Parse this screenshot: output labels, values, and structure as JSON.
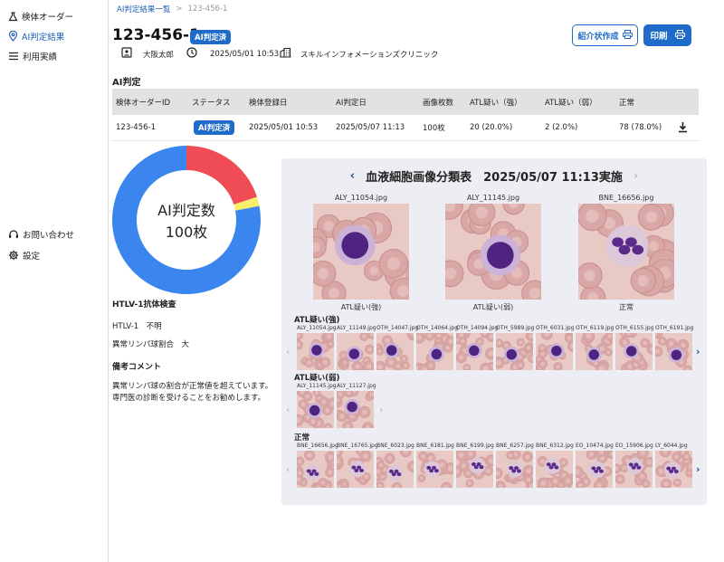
{
  "sidebar": {
    "items": [
      {
        "label": "検体オーダー",
        "icon": "flask-icon"
      },
      {
        "label": "AI判定結果",
        "icon": "location-pin-icon"
      },
      {
        "label": "利用実績",
        "icon": "list-icon"
      }
    ],
    "bottom_items": [
      {
        "label": "お問い合わせ",
        "icon": "headset-icon"
      },
      {
        "label": "設定",
        "icon": "gear-icon"
      }
    ]
  },
  "breadcrumb": {
    "parent": "AI判定結果一覧",
    "separator": ">",
    "current": "123-456-1"
  },
  "header": {
    "title": "123-456-1",
    "status_badge": "AI判定済",
    "patient_name": "大阪太郎",
    "datetime": "2025/05/01 10:53",
    "clinic": "スキルインフォメーションズクリニック",
    "referral_button": "紹介状作成",
    "print_button": "印刷"
  },
  "section_title": "AI判定",
  "table": {
    "headers": [
      "検体オーダーID",
      "ステータス",
      "検体登録日",
      "AI判定日",
      "画像枚数",
      "ATL疑い（強）",
      "ATL疑い（弱）",
      "正常"
    ],
    "row": {
      "order_id": "123-456-1",
      "status": "AI判定済",
      "registered": "2025/05/01 10:53",
      "ai_date": "2025/05/07 11:13",
      "image_count": "100枚",
      "atl_strong": "20 (20.0%)",
      "atl_weak": "2 (2.0%)",
      "normal": "78 (78.0%)"
    }
  },
  "donut": {
    "center_label": "AI判定数",
    "center_value": "100枚",
    "segments": [
      {
        "name": "ATL疑い（強）",
        "value": 20,
        "color": "#f04c55"
      },
      {
        "name": "ATL疑い（弱）",
        "value": 2,
        "color": "#f7ee6a"
      },
      {
        "name": "正常",
        "value": 78,
        "color": "#3b86ee"
      }
    ]
  },
  "antibody": {
    "title": "HTLV-1抗体検査",
    "htlv": "HTLV-1　不明",
    "abnormal_ratio": "異常リンパ球割合　大"
  },
  "comment": {
    "title": "備考コメント",
    "text": "異常リンパ球の割合が正常値を超えています。専門医の診断を受けることをお勧めします。"
  },
  "panel": {
    "title": "血液細胞画像分類表　2025/05/07 11:13実施",
    "featured": [
      {
        "filename": "ALY_11054.jpg",
        "caption": "ATL疑い(強)"
      },
      {
        "filename": "ALY_11145.jpg",
        "caption": "ATL疑い(弱)"
      },
      {
        "filename": "BNE_16656.jpg",
        "caption": "正常"
      }
    ],
    "groups": [
      {
        "title": "ATL疑い(強)",
        "files": [
          "ALY_11054.jpg",
          "ALY_11149.jpg",
          "OTH_14047.jpg",
          "OTH_14064.jpg",
          "OTH_14094.jpg",
          "OTH_5989.jpg",
          "OTH_6031.jpg",
          "OTH_6119.jpg",
          "OTH_6155.jpg",
          "OTH_6191.jpg"
        ]
      },
      {
        "title": "ATL疑い(弱)",
        "files": [
          "ALY_11145.jpg",
          "ALY_11127.jpg"
        ]
      },
      {
        "title": "正常",
        "files": [
          "BNE_16656.jpg",
          "BNE_16765.jpg",
          "BNE_6023.jpg",
          "BNE_6181.jpg",
          "BNE_6199.jpg",
          "BNE_6257.jpg",
          "BNE_6312.jpg",
          "EO_10474.jpg",
          "EO_15906.jpg",
          "LY_6044.jpg"
        ]
      }
    ]
  }
}
